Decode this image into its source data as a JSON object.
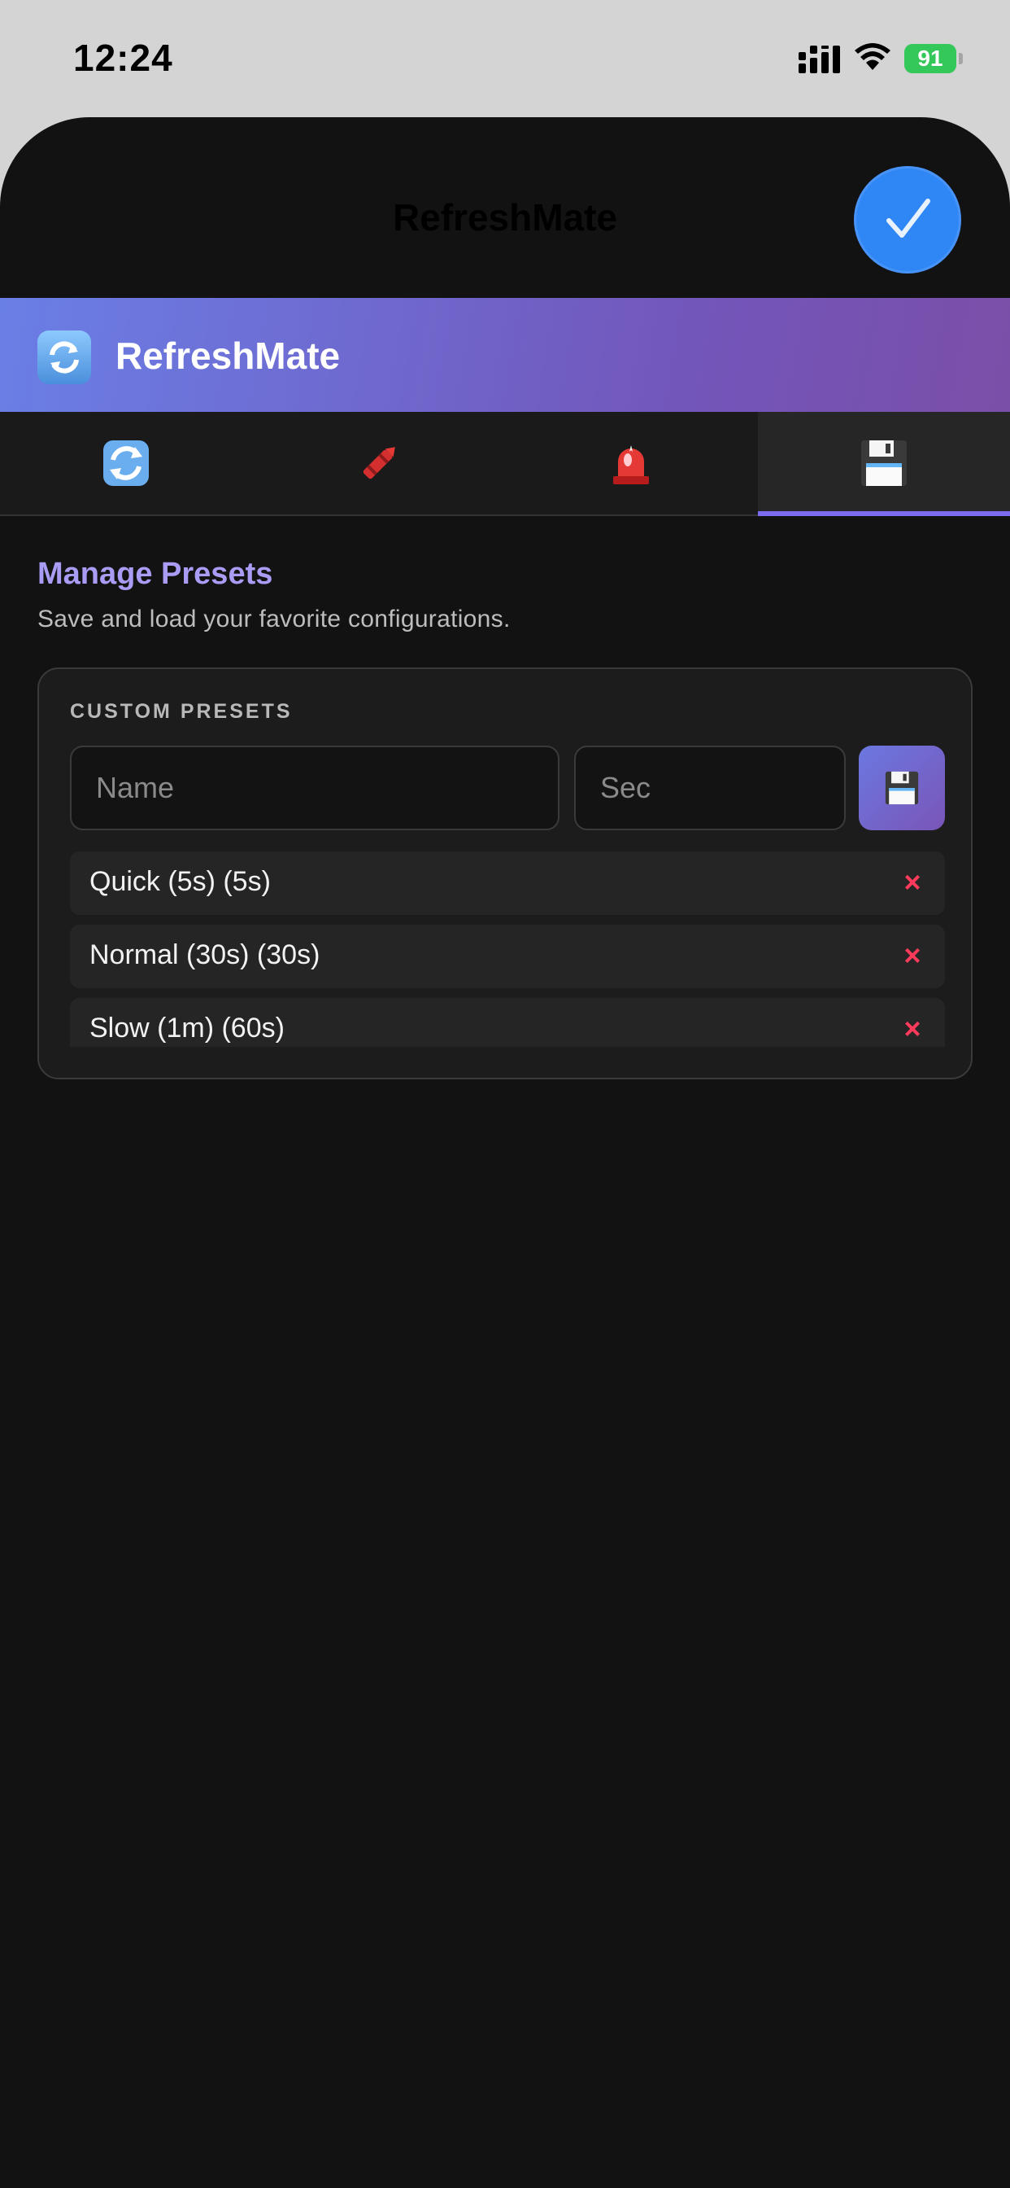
{
  "status_bar": {
    "time": "12:24",
    "battery": "91"
  },
  "sheet": {
    "title": "RefreshMate",
    "done_icon": "checkmark-icon"
  },
  "app": {
    "title": "RefreshMate",
    "icon": "refresh-icon",
    "accent": "#7b6cf0"
  },
  "tabs": [
    {
      "icon": "refresh-icon",
      "active": false
    },
    {
      "icon": "crayon-icon",
      "active": false
    },
    {
      "icon": "siren-icon",
      "active": false
    },
    {
      "icon": "floppy-disk-icon",
      "active": true
    }
  ],
  "presets_section": {
    "title": "Manage Presets",
    "subtitle": "Save and load your favorite configurations.",
    "card_label": "CUSTOM PRESETS",
    "name_placeholder": "Name",
    "sec_placeholder": "Sec",
    "delete_symbol": "×",
    "items": [
      {
        "label": "Quick (5s) (5s)"
      },
      {
        "label": "Normal (30s) (30s)"
      },
      {
        "label": "Slow (1m) (60s)"
      }
    ]
  }
}
